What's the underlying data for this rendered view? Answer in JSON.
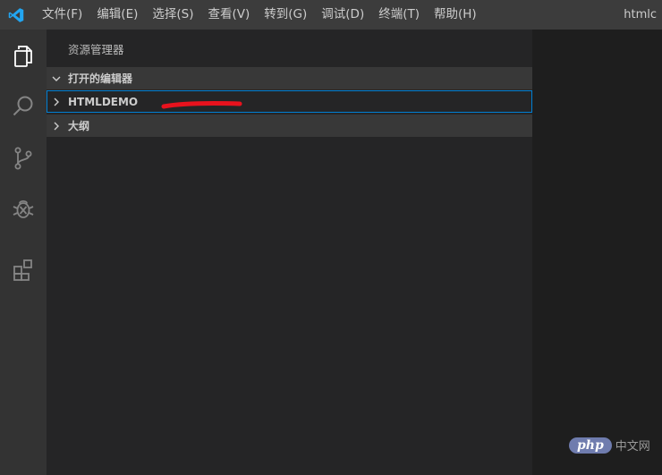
{
  "menu": {
    "items": [
      "文件(F)",
      "编辑(E)",
      "选择(S)",
      "查看(V)",
      "转到(G)",
      "调试(D)",
      "终端(T)",
      "帮助(H)"
    ]
  },
  "window": {
    "title": "htmlc"
  },
  "activitybar": {
    "icons": [
      "files-icon",
      "search-icon",
      "source-control-icon",
      "debug-icon",
      "extensions-icon"
    ]
  },
  "sidebar": {
    "title": "资源管理器",
    "sections": [
      {
        "label": "打开的编辑器",
        "expanded": true
      },
      {
        "label": "HTMLDEMO",
        "expanded": false,
        "focused": true
      },
      {
        "label": "大纲",
        "expanded": false
      }
    ]
  },
  "watermark": {
    "brand": "php",
    "text": "中文网"
  },
  "colors": {
    "titlebar": "#3c3c3c",
    "activitybar": "#333333",
    "sidebar": "#252526",
    "section_header": "#383838",
    "editor": "#1e1e1e",
    "focus_border": "#007fd4",
    "logo": "#22a6f2",
    "annotation": "#e8121d"
  }
}
